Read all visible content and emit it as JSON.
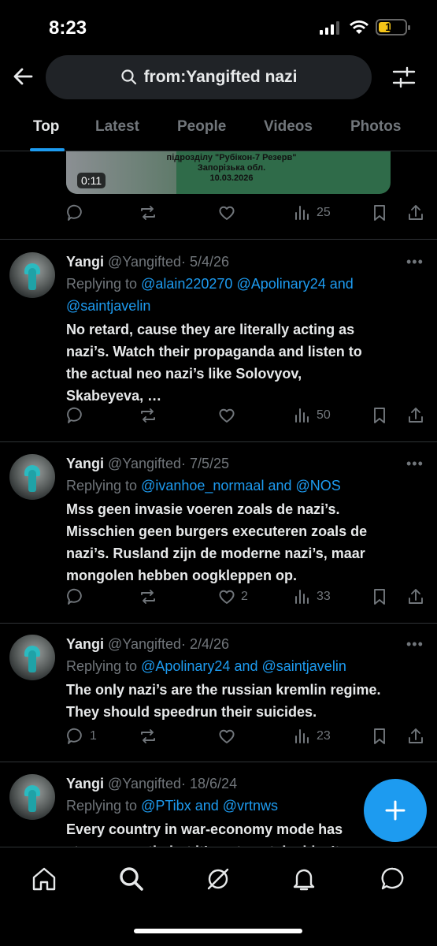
{
  "status": {
    "time": "8:23",
    "battery": "15"
  },
  "search": {
    "query": "from:Yangifted nazi"
  },
  "tabs": [
    {
      "label": "Top"
    },
    {
      "label": "Latest"
    },
    {
      "label": "People"
    },
    {
      "label": "Videos"
    },
    {
      "label": "Photos"
    }
  ],
  "video": {
    "duration": "0:11",
    "overlay_lines": [
      "підрозділу \"Рубікон-7 Резерв\"",
      "Запорізька обл.",
      "10.03.2026"
    ],
    "views": "25"
  },
  "tweets": [
    {
      "name": "Yangi",
      "handle": "@Yangifted",
      "date": "· 5/4/26",
      "replying_prefix": "Replying to",
      "mentions_line1": "@alain220270 @Apolinary24 and",
      "mentions_line2": "@saintjavelin",
      "body_lines": [
        "No retard, cause they are literally acting as",
        "nazi’s. Watch their propaganda and listen to",
        "the actual neo nazi’s like Solovyov,",
        "Skabeyeva, …"
      ],
      "replies": "",
      "likes": "",
      "views": "50"
    },
    {
      "name": "Yangi",
      "handle": "@Yangifted",
      "date": "· 7/5/25",
      "replying_prefix": "Replying to",
      "mention_a": "@ivanhoe_normaal",
      "and_word": "and",
      "mention_b": "@NOS",
      "body_lines": [
        "Mss geen invasie voeren zoals de nazi’s.",
        "Misschien geen burgers executeren zoals de",
        "nazi’s. Rusland zijn de moderne nazi’s, maar",
        "mongolen hebben oogkleppen op."
      ],
      "replies": "",
      "likes": "2",
      "views": "33"
    },
    {
      "name": "Yangi",
      "handle": "@Yangifted",
      "date": "· 2/4/26",
      "replying_prefix": "Replying to",
      "mention_a": "@Apolinary24",
      "and_word": "and",
      "mention_b": "@saintjavelin",
      "body_lines": [
        "The only nazi’s are the russian kremlin regime.",
        "They should speedrun their suicides."
      ],
      "replies": "1",
      "likes": "",
      "views": "23"
    },
    {
      "name": "Yangi",
      "handle": "@Yangifted",
      "date": "· 18/6/24",
      "replying_prefix": "Replying to",
      "mention_a": "@PTibx",
      "and_word": "and",
      "mention_b": "@vrtnws",
      "body_lines": [
        "Every country in war-economy mode has",
        "strong growth, but it’s not sustainable. It"
      ]
    }
  ],
  "colors": {
    "accent": "#1d9bf0",
    "background": "#000000",
    "muted": "#71767b"
  }
}
